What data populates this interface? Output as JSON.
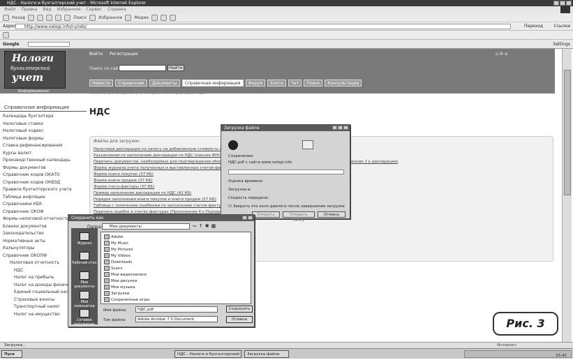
{
  "window": {
    "title": "НДС - Налоги и бухгалтерский учет - Microsoft Internet Explorer"
  },
  "menu": [
    "Файл",
    "Правка",
    "Вид",
    "Избранное",
    "Сервис",
    "Справка"
  ],
  "toolbar": {
    "back": "Назад",
    "search": "Поиск",
    "favorites": "Избранное",
    "media": "Медиа"
  },
  "address": {
    "label": "Адрес",
    "url": "http://www.nalogi.info/ru/nds/",
    "go": "Переход",
    "links": "Ссылки"
  },
  "googlebar": {
    "label": "Google",
    "settings": "Settings"
  },
  "site": {
    "logo_line1": "Налоги",
    "logo_line2": "бухгалтерский",
    "logo_line3": "учет",
    "logo_sub": "Информационно-справочный портал",
    "top_links": [
      "Войти",
      "Регистрация"
    ],
    "search_label": "Поиск по сайту:",
    "search_button": "Найти",
    "nav_tabs": [
      "Новости",
      "Справочник",
      "Документы",
      "Справочная информация",
      "Форум",
      "Блоги",
      "Чат",
      "Поиск",
      "Консультации"
    ],
    "active_tab": 3,
    "breadcrumb": "Налоги и бухгалтерский учет / Справочная информация / НДС",
    "page_title": "НДС",
    "files_title": "Файлы для загрузки:",
    "files": [
      "Налоговая декларация по налогу на добавленную стоимость (утв. приказом Минфина РФ от 07.11.2006 № 136н) (71 КБ)",
      "Разъяснения по заполнению декларации по НДС (письмо ФНС России от 2009 г., размер – 54 КБ) (93 КБ)",
      "Перечень документов, необходимых для подтверждения обоснованности применения налоговой ставки 0 процентов (Приложение 2 к декларации)",
      "Форма журнала учета полученных и выставленных счетов-фактур (47 КБ)",
      "Форма книги покупок (37 КБ)",
      "Форма книги продаж (37 КБ)",
      "Форма счета-фактуры (37 КБ)",
      "Пример заполнения декларации по НДС (42 КБ)",
      "Порядок заполнения книги покупок и книги продаж (57 КБ)",
      "Таблица с типичными ошибками по заполнению счетов-фактур (Приложение 3 к Порядку)",
      "Перечень ошибок в счетах-фактурах (Приложение 4 к Порядку)",
      "Справочник кодов видов операций (Приложение 5 к Порядку) (41 КБ)"
    ],
    "sidebar_title": "Справочная информация",
    "sidebar": [
      "Календарь бухгалтера",
      "Налоговые ставки",
      "Налоговый кодекс",
      "Налоговые формы",
      "Ставка рефинансирования",
      "Курсы валют",
      "Производственный календарь",
      "Формы документов",
      "Справочник кодов ОКАТО",
      "Справочник кодов ОКВЭД",
      "Правила бухгалтерского учета",
      "Таблица инфляции",
      "Справочники КБК",
      "Справочник ОКОФ",
      "Формы налоговой отчетности",
      "Бланки документов",
      "Законодательство",
      "Нормативные акты",
      "Калькуляторы",
      "Справочник ОКОПФ",
      "Налоговая отчетность",
      "НДС",
      "Налог на прибыль",
      "Налог на доходы физических лиц",
      "Единый социальный налог",
      "Страховые взносы",
      "Транспортный налог",
      "Налог на имущество"
    ]
  },
  "download_dialog": {
    "title": "Загрузка файла",
    "line1": "Сохранение:",
    "line2": "НДС.pdf с сайта www.nalogi.info",
    "line3": "Оценка времени:",
    "line4": "Загрузка в:",
    "line5": "Скорость передачи:",
    "checkbox": "Закрыть это окно диалога после завершения загрузки",
    "btn_open": "Открыть",
    "btn_open_folder": "Открыть папку",
    "btn_cancel": "Отмена"
  },
  "save_dialog": {
    "title": "Сохранить как",
    "look_in_label": "Папка:",
    "look_in": "Мои документы",
    "places": [
      "Журнал",
      "Рабочий стол",
      "Мои документы",
      "Мой компьютер",
      "Сетевое окружение"
    ],
    "files": [
      "Adobe",
      "My Music",
      "My Pictures",
      "My Videos",
      "Downloads",
      "Scans",
      "Мои видеозаписи",
      "Мои рисунки",
      "Моя музыка",
      "Загрузки",
      "Сохраненные игры"
    ],
    "filename_label": "Имя файла:",
    "filename": "НДС.pdf",
    "filetype_label": "Тип файла:",
    "filetype": "Adobe Acrobat 7.0 Document",
    "btn_save": "Сохранить",
    "btn_cancel": "Отмена"
  },
  "figure_label": "Рис. 3",
  "status": {
    "text": "Загрузка...",
    "zone": "Интернет"
  },
  "taskbar": {
    "start": "Пуск",
    "tasks": [
      "НДС - Налоги и бухгалтерский учет",
      "Загрузка файла"
    ],
    "clock": "15:42"
  }
}
